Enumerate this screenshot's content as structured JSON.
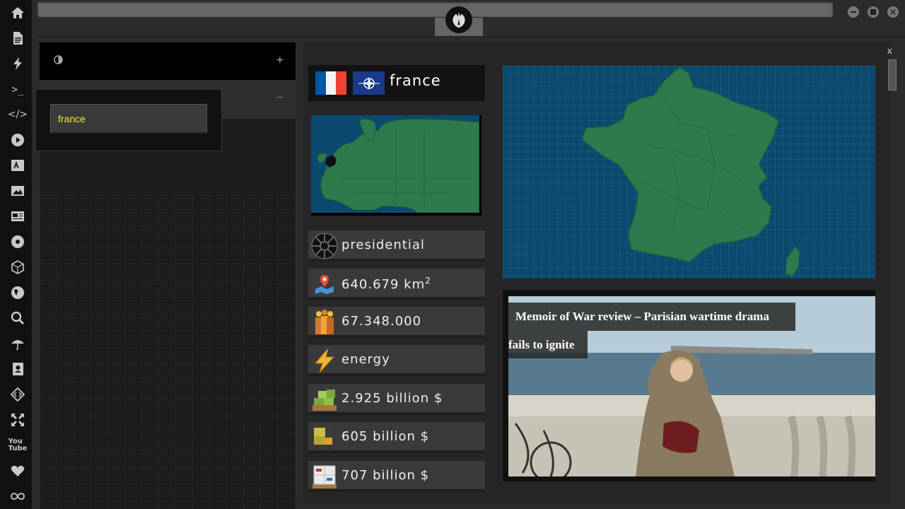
{
  "app": {
    "search_value": "france",
    "close_label": "x",
    "toggle_plus": "+",
    "toggle_minus": "−"
  },
  "rail_icons": [
    "home-icon",
    "document-icon",
    "bolt-icon",
    "terminal-icon",
    "code-icon",
    "play-icon",
    "translate-icon",
    "image-icon",
    "newspaper-icon",
    "empire-icon",
    "cube-icon",
    "globe-icon",
    "search-icon",
    "umbrella-icon",
    "contacts-icon",
    "diamond-code-icon",
    "expand-icon",
    "youtube-icon",
    "heart-icon",
    "infinity-icon"
  ],
  "country": {
    "name": "france",
    "flag_colors": [
      "#0055a4",
      "#ffffff",
      "#ef4135"
    ],
    "stats": [
      {
        "icon": "government-icon",
        "text": "presidential"
      },
      {
        "icon": "area-map-icon",
        "text": "640.679 km",
        "sup": "2"
      },
      {
        "icon": "population-icon",
        "text": "67.348.000"
      },
      {
        "icon": "energy-icon",
        "text": "energy"
      },
      {
        "icon": "gdp-icon",
        "text": "2.925 billion $"
      },
      {
        "icon": "exports-icon",
        "text": "605 billion $"
      },
      {
        "icon": "imports-icon",
        "text": "707 billion $"
      }
    ]
  },
  "news": {
    "headline_line1": "Memoir of War review – Parisian wartime drama",
    "headline_line2": "fails to ignite"
  },
  "colors": {
    "map_sea": "#0b4a6e",
    "map_land": "#2f7a4c",
    "accent_text": "#e8e83a"
  }
}
